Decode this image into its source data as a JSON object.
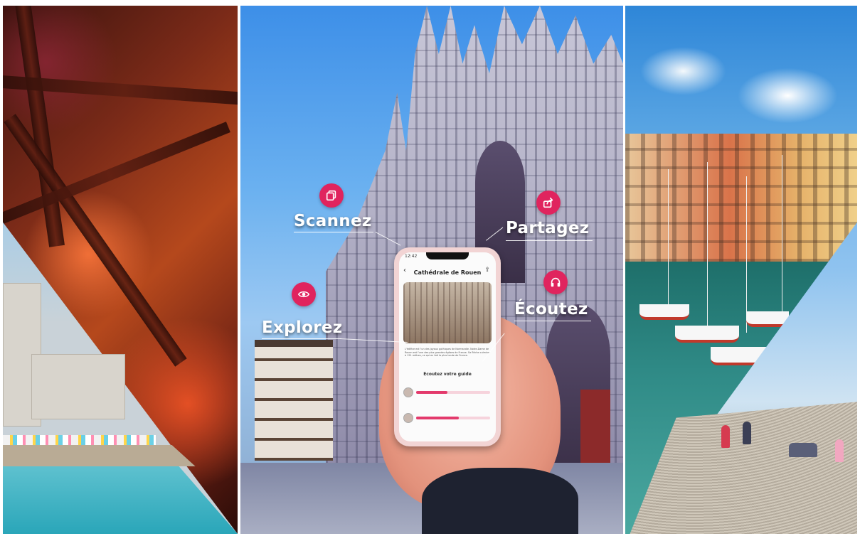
{
  "features": {
    "scan": {
      "label": "Scannez",
      "icon": "copy-icon"
    },
    "share": {
      "label": "Partagez",
      "icon": "share-icon"
    },
    "explore": {
      "label": "Explorez",
      "icon": "eye-icon"
    },
    "listen": {
      "label": "Écoutez",
      "icon": "headphones-icon"
    }
  },
  "phone": {
    "time": "12:42",
    "title": "Cathédrale de Rouen",
    "description": "L'édifice est l'un des joyaux gothiques de Normandie. Notre-Dame de Rouen est l'une des plus grandes églises de France. Sa flèche culmine à 151 mètres, ce qui en fait la plus haute de France.",
    "guide_label": "Ecoutez votre guide",
    "tracks": [
      {
        "avatar": "narrator-avatar",
        "progress": 0.42
      },
      {
        "avatar": "guide-avatar",
        "progress": 0.58
      }
    ]
  },
  "colors": {
    "badge": "#e0245e",
    "label_text": "#ffffff"
  }
}
